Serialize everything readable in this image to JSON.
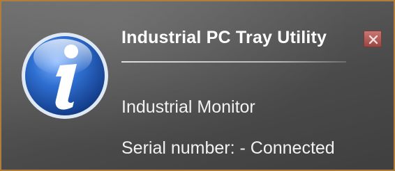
{
  "notification": {
    "title": "Industrial PC Tray Utility",
    "device": "Industrial Monitor",
    "status": "Serial number:  - Connected",
    "icon": "info-icon",
    "close_icon": "close-icon"
  },
  "colors": {
    "border": "#b07d3a",
    "background": "#555555",
    "text": "#ffffff",
    "icon_blue": "#2f6fd1",
    "close_red": "#b25a56"
  }
}
